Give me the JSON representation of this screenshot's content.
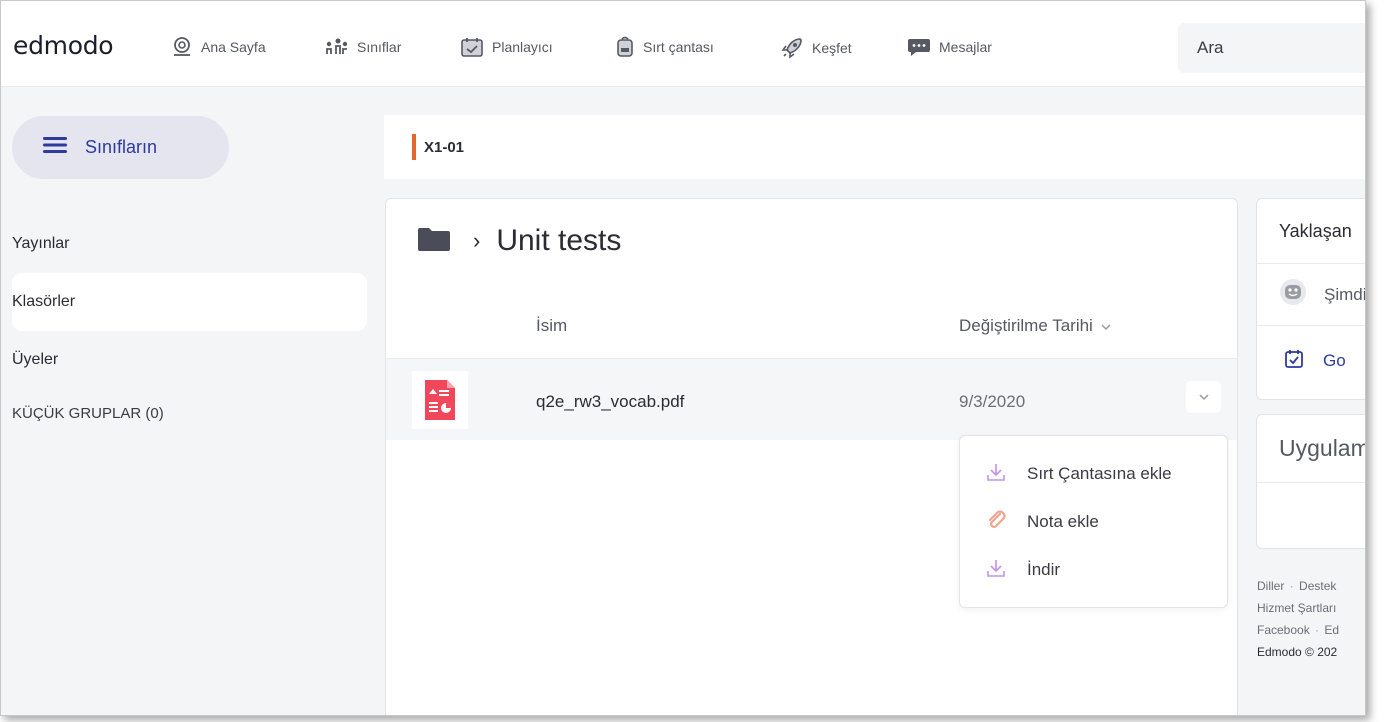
{
  "app": {
    "logo": "edmodo"
  },
  "nav": {
    "items": [
      {
        "label": "Ana Sayfa",
        "icon": "home-icon"
      },
      {
        "label": "Sınıflar",
        "icon": "classes-icon"
      },
      {
        "label": "Planlayıcı",
        "icon": "planner-icon"
      },
      {
        "label": "Sırt çantası",
        "icon": "backpack-icon"
      },
      {
        "label": "Keşfet",
        "icon": "rocket-icon"
      },
      {
        "label": "Mesajlar",
        "icon": "messages-icon"
      }
    ],
    "search_placeholder": "Ara"
  },
  "sidebar": {
    "classes_button": "Sınıfların",
    "items": [
      {
        "label": "Yayınlar",
        "active": false
      },
      {
        "label": "Klasörler",
        "active": true
      },
      {
        "label": "Üyeler",
        "active": false
      }
    ],
    "groups_label": "KÜÇÜK GRUPLAR (0)"
  },
  "class": {
    "name": "X1-01",
    "accent_color": "#e2672d"
  },
  "folder": {
    "title": "Unit tests",
    "columns": {
      "name": "İsim",
      "modified": "Değiştirilme Tarihi"
    },
    "files": [
      {
        "name": "q2e_rw3_vocab.pdf",
        "date": "9/3/2020",
        "icon": "pdf-file-icon"
      }
    ]
  },
  "dropdown": {
    "items": [
      {
        "label": "Sırt Çantasına ekle",
        "icon": "download-icon"
      },
      {
        "label": "Nota ekle",
        "icon": "paperclip-icon"
      },
      {
        "label": "İndir",
        "icon": "download-icon"
      }
    ]
  },
  "right": {
    "upcoming_title": "Yaklaşan",
    "upcoming_row": "Şimdi",
    "planner_link": "Go",
    "apps_title": "Uygulama"
  },
  "footer": {
    "line1": [
      "Diller",
      "Destek"
    ],
    "line2": "Hizmet Şartları",
    "line3": [
      "Facebook",
      "Ed"
    ],
    "copyright": "Edmodo © 202"
  },
  "colors": {
    "brand_blue": "#2d3a9e",
    "pdf_red": "#f0485a",
    "menu_purple": "#c392e6",
    "clip_orange": "#f0a58e"
  }
}
